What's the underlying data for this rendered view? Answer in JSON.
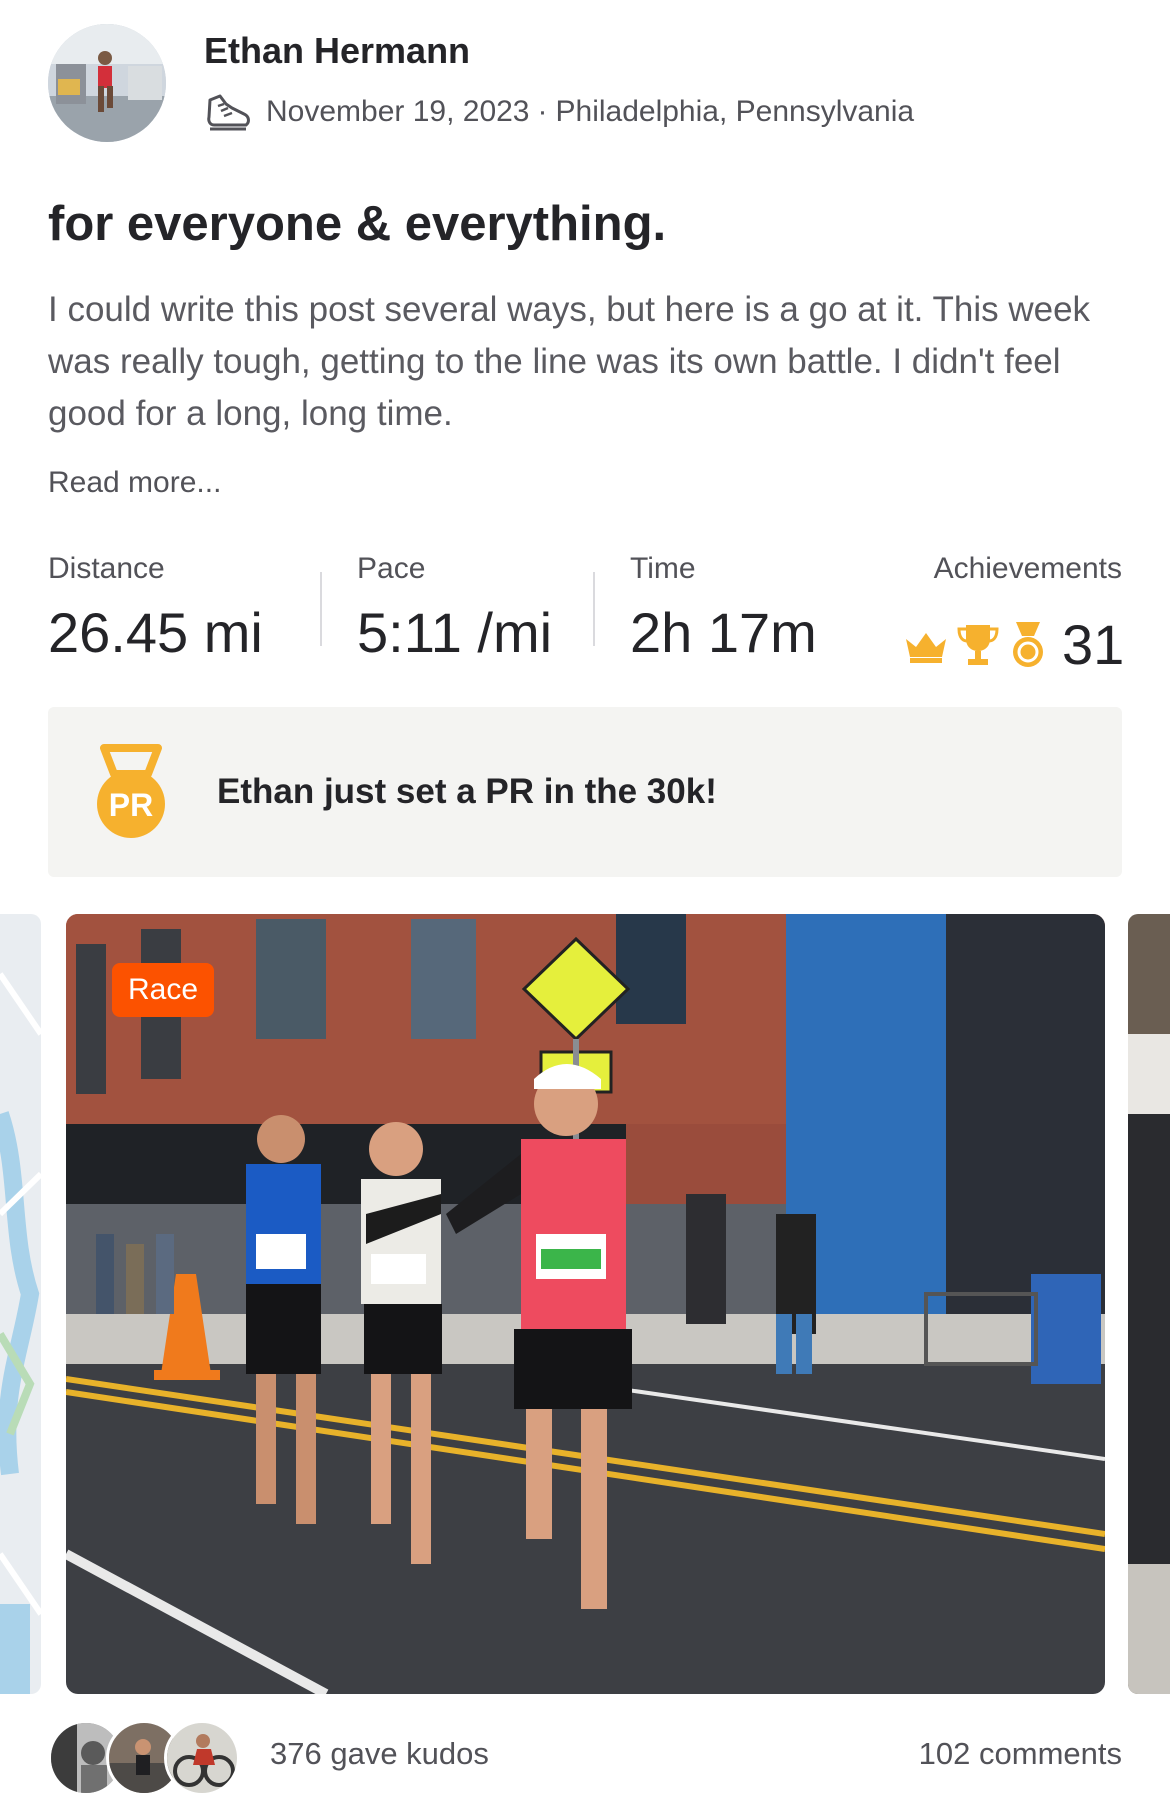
{
  "athlete": {
    "name": "Ethan Hermann"
  },
  "activity": {
    "date": "November 19, 2023",
    "separator": "·",
    "location": "Philadelphia, Pennsylvania",
    "title": "for everyone & everything.",
    "description": "I could write this post several ways, but here is a go at it.  This week was really tough, getting to the line was its own battle. I didn't feel good for a long, long time.",
    "read_more": "Read more..."
  },
  "stats": {
    "distance": {
      "label": "Distance",
      "value": "26.45 mi"
    },
    "pace": {
      "label": "Pace",
      "value": "5:11 /mi"
    },
    "time": {
      "label": "Time",
      "value": "2h 17m"
    },
    "achievements": {
      "label": "Achievements",
      "value": "31"
    }
  },
  "pr_banner": {
    "badge_text": "PR",
    "text": "Ethan just set a PR in the 30k!"
  },
  "media": {
    "badge": "Race"
  },
  "footer": {
    "kudos": "376 gave kudos",
    "comments": "102 comments"
  },
  "colors": {
    "brand_orange": "#fc5200",
    "gold": "#f6b12e",
    "card_bg": "#f4f4f2"
  },
  "icons": [
    "running-shoe-icon",
    "crown-icon",
    "trophy-icon",
    "medal-icon",
    "pr-medal-icon"
  ]
}
